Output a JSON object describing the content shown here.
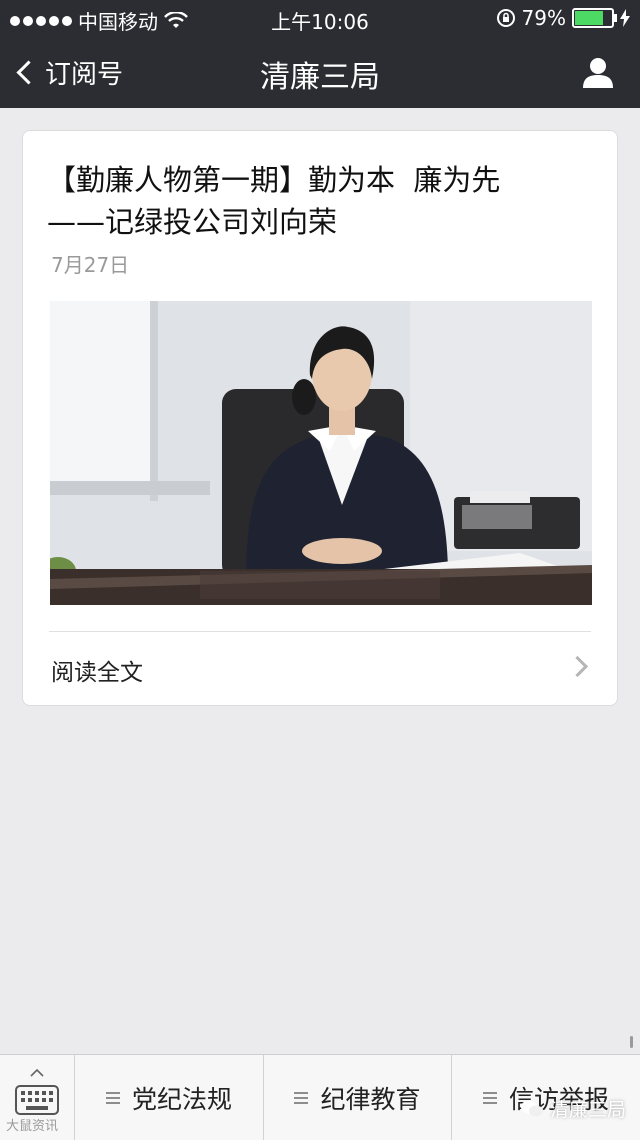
{
  "status_bar": {
    "carrier": "中国移动",
    "time": "上午10:06",
    "battery_percent": "79%",
    "battery_level": 0.79
  },
  "nav": {
    "back_label": "订阅号",
    "title": "清廉三局"
  },
  "article": {
    "headline_line1": "【勤廉人物第一期】勤为本  廉为先",
    "headline_line2": "——记绿投公司刘向荣",
    "date": "7月27日",
    "read_all_label": "阅读全文"
  },
  "bottom_menu": {
    "items": [
      {
        "label": "党纪法规"
      },
      {
        "label": "纪律教育"
      },
      {
        "label": "信访举报"
      }
    ]
  },
  "watermark": {
    "left": "大鼠资讯",
    "right": "清廉三局"
  },
  "colors": {
    "nav_bg": "#2c2d32",
    "page_bg": "#ebebee",
    "battery_green": "#4cd964"
  }
}
